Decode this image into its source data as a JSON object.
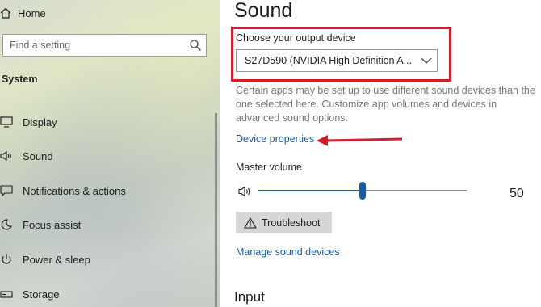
{
  "sidebar": {
    "home_label": "Home",
    "search_placeholder": "Find a setting",
    "section_title": "System",
    "items": [
      {
        "label": "Display",
        "icon": "display-icon"
      },
      {
        "label": "Sound",
        "icon": "sound-icon"
      },
      {
        "label": "Notifications & actions",
        "icon": "notifications-icon"
      },
      {
        "label": "Focus assist",
        "icon": "focus-assist-icon"
      },
      {
        "label": "Power & sleep",
        "icon": "power-icon"
      },
      {
        "label": "Storage",
        "icon": "storage-icon"
      }
    ]
  },
  "main": {
    "title": "Sound",
    "output_label": "Choose your output device",
    "output_device": "S27D590 (NVIDIA High Definition A...",
    "description": "Certain apps may be set up to use different sound devices than the one selected here. Customize app volumes and devices in advanced sound options.",
    "device_properties_link": "Device properties",
    "master_volume_label": "Master volume",
    "master_volume_value": "50",
    "master_volume_level": 0.5,
    "troubleshoot_label": "Troubleshoot",
    "manage_devices_link": "Manage sound devices",
    "input_heading": "Input"
  },
  "colors": {
    "accent": "#1a5aa8",
    "annotation_red": "#d21f2c"
  }
}
